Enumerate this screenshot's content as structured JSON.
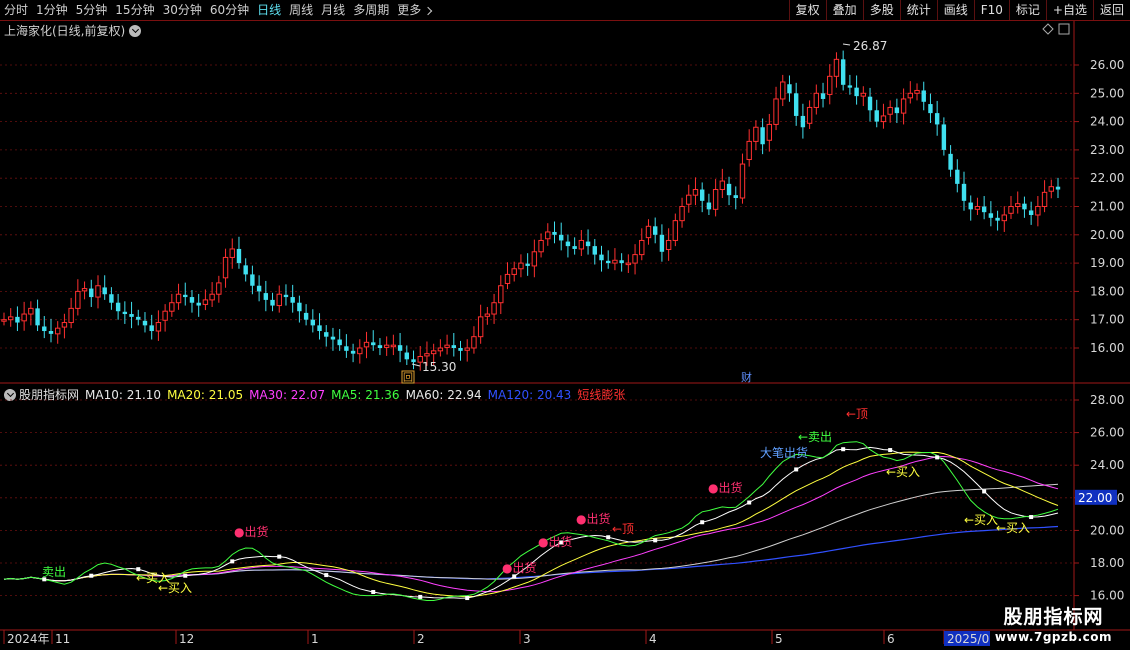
{
  "toolbar": {
    "periods": [
      {
        "label": "分时",
        "active": false
      },
      {
        "label": "1分钟",
        "active": false
      },
      {
        "label": "5分钟",
        "active": false
      },
      {
        "label": "15分钟",
        "active": false
      },
      {
        "label": "30分钟",
        "active": false
      },
      {
        "label": "60分钟",
        "active": false
      },
      {
        "label": "日线",
        "active": true
      },
      {
        "label": "周线",
        "active": false
      },
      {
        "label": "月线",
        "active": false
      },
      {
        "label": "多周期",
        "active": false
      },
      {
        "label": "更多",
        "active": false
      }
    ],
    "right_buttons": [
      "复权",
      "叠加",
      "多股",
      "统计",
      "画线",
      "F10",
      "标记",
      "+自选",
      "返回"
    ]
  },
  "main_chart": {
    "title": "上海家化(日线,前复权)",
    "y_ticks": [
      "26.00",
      "25.00",
      "24.00",
      "23.00",
      "22.00",
      "21.00",
      "20.00",
      "19.00",
      "18.00",
      "17.00",
      "16.00"
    ],
    "high_label": "26.87",
    "low_label": "15.30",
    "finance_marker": "财",
    "low_marker": "回"
  },
  "indicator": {
    "name": "股朋指标网",
    "items": [
      {
        "text": "MA10: 21.10",
        "color": "#e8e8e8"
      },
      {
        "text": "MA20: 21.05",
        "color": "#ffff40"
      },
      {
        "text": "MA30: 22.07",
        "color": "#ff40ff"
      },
      {
        "text": "MA5: 21.36",
        "color": "#40ff40"
      },
      {
        "text": "MA60: 22.94",
        "color": "#e8e8e8"
      },
      {
        "text": "MA120: 20.43",
        "color": "#3050ff"
      },
      {
        "text": "短线膨张",
        "color": "#ff3030"
      }
    ],
    "y_ticks": [
      "28.00",
      "26.00",
      "24.00",
      "22.00",
      "20.00",
      "18.00",
      "16.00"
    ],
    "current_value": "22.00",
    "signals": [
      {
        "text": "卖出",
        "color": "#40ff40"
      },
      {
        "text": "←买入",
        "color": "#ffff40"
      },
      {
        "text": "←买入",
        "color": "#ffff40"
      },
      {
        "text": "●出货",
        "color": "#ff3070"
      },
      {
        "text": "●出货",
        "color": "#ff3070"
      },
      {
        "text": "●出货",
        "color": "#ff3070"
      },
      {
        "text": "●出货",
        "color": "#ff3070"
      },
      {
        "text": "←顶",
        "color": "#ff3030"
      },
      {
        "text": "●出货",
        "color": "#ff3070"
      },
      {
        "text": "大笔出货",
        "color": "#60a0ff"
      },
      {
        "text": "←卖出",
        "color": "#40ff40"
      },
      {
        "text": "←顶",
        "color": "#ff3030"
      },
      {
        "text": "←买入",
        "color": "#ffff40"
      },
      {
        "text": "←买入",
        "color": "#ffff40"
      },
      {
        "text": "←买入",
        "color": "#ffff40"
      }
    ]
  },
  "x_axis": {
    "labels": [
      "2024年",
      "11",
      "12",
      "1",
      "2",
      "3",
      "4",
      "5",
      "6",
      "2025/0"
    ]
  },
  "watermark": {
    "main": "股朋指标网",
    "sub": "www.7gpzb.com"
  },
  "colors": {
    "up": "#ff3030",
    "down": "#40e0f0",
    "grid": "#6a1010",
    "axis": "#a01818"
  }
}
